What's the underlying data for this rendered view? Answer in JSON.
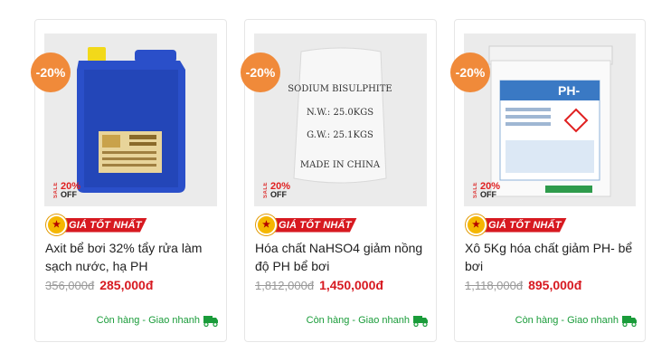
{
  "products": [
    {
      "discount": "-20%",
      "sale_vert": "SALE",
      "sale_pct": "20%",
      "sale_off": "OFF",
      "best_label": "GIÁ TỐT NHẤT",
      "title": "Axit bể bơi 32% tẩy rửa làm sạch nước, hạ PH",
      "old_price": "356,000đ",
      "new_price": "285,000đ",
      "shipping": "Còn hàng - Giao nhanh",
      "image_icon": "blue-jerrycan"
    },
    {
      "discount": "-20%",
      "sale_vert": "SALE",
      "sale_pct": "20%",
      "sale_off": "OFF",
      "best_label": "GIÁ TỐT NHẤT",
      "title": "Hóa chất NaHSO4 giảm nồng độ PH bể bơi",
      "old_price": "1,812,000đ",
      "new_price": "1,450,000đ",
      "shipping": "Còn hàng - Giao nhanh",
      "image_icon": "white-sack",
      "sack_text": [
        "SODIUM BISULPHITE",
        "N.W.: 25.0KGS",
        "G.W.: 25.1KGS",
        "MADE IN CHINA"
      ]
    },
    {
      "discount": "-20%",
      "sale_vert": "SALE",
      "sale_pct": "20%",
      "sale_off": "OFF",
      "best_label": "GIÁ TỐT NHẤT",
      "title": "Xô 5Kg hóa chất giảm PH- bể bơi",
      "old_price": "1,118,000đ",
      "new_price": "895,000đ",
      "shipping": "Còn hàng - Giao nhanh",
      "image_icon": "bucket",
      "bucket_label": "PH-"
    }
  ],
  "colors": {
    "discount_badge": "#f08a3a",
    "price_red": "#d71920",
    "ship_green": "#1a9c3a"
  }
}
